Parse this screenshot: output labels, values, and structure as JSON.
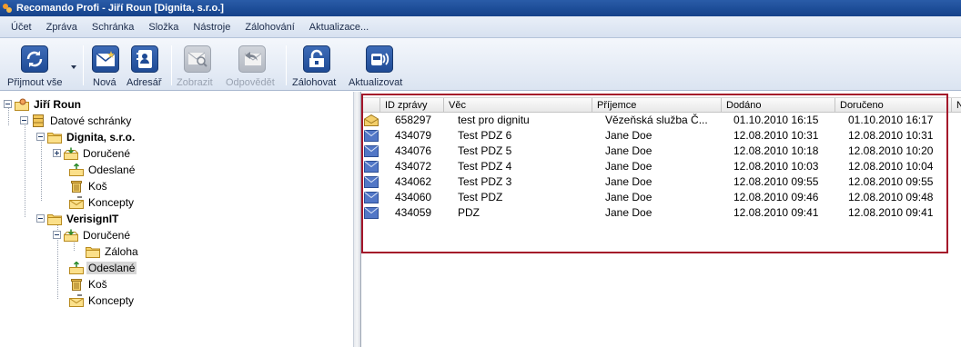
{
  "window": {
    "title": "Recomando Profi - Jiří Roun [Dignita, s.r.o.]"
  },
  "menu": [
    "Účet",
    "Zpráva",
    "Schránka",
    "Složka",
    "Nástroje",
    "Zálohování",
    "Aktualizace..."
  ],
  "toolbar": {
    "receive_all": "Přijmout vše",
    "new": "Nová",
    "address_book": "Adresář",
    "show": "Zobrazit",
    "reply": "Odpovědět",
    "backup": "Zálohovat",
    "update": "Aktualizovat"
  },
  "tree": {
    "root": "Jiří Roun",
    "boxes": "Datové schránky",
    "account1": "Dignita, s.r.o.",
    "account1_items": [
      "Doručené",
      "Odeslané",
      "Koš",
      "Koncepty"
    ],
    "account2": "VerisignIT",
    "account2_inbox": "Doručené",
    "account2_inbox_sub": "Záloha",
    "account2_items": [
      "Odeslané",
      "Koš",
      "Koncepty"
    ]
  },
  "list": {
    "columns": [
      "ID zprávy",
      "Věc",
      "Příjemce",
      "Dodáno",
      "Doručeno",
      "N"
    ],
    "rows": [
      {
        "icon": "open-envelope-icon",
        "id": "658297",
        "subject": "test pro dignitu",
        "recipient": "Vězeňská služba Č...",
        "delivered": "01.10.2010 16:15",
        "received": "01.10.2010 16:17"
      },
      {
        "icon": "envelope-icon",
        "id": "434079",
        "subject": "Test PDZ 6",
        "recipient": "Jane Doe",
        "delivered": "12.08.2010 10:31",
        "received": "12.08.2010 10:31"
      },
      {
        "icon": "envelope-icon",
        "id": "434076",
        "subject": "Test PDZ 5",
        "recipient": "Jane Doe",
        "delivered": "12.08.2010 10:18",
        "received": "12.08.2010 10:20"
      },
      {
        "icon": "envelope-icon",
        "id": "434072",
        "subject": "Test PDZ 4",
        "recipient": "Jane Doe",
        "delivered": "12.08.2010 10:03",
        "received": "12.08.2010 10:04"
      },
      {
        "icon": "envelope-icon",
        "id": "434062",
        "subject": "Test PDZ 3",
        "recipient": "Jane Doe",
        "delivered": "12.08.2010 09:55",
        "received": "12.08.2010 09:55"
      },
      {
        "icon": "envelope-icon",
        "id": "434060",
        "subject": "Test PDZ",
        "recipient": "Jane Doe",
        "delivered": "12.08.2010 09:46",
        "received": "12.08.2010 09:48"
      },
      {
        "icon": "envelope-icon",
        "id": "434059",
        "subject": "PDZ",
        "recipient": "Jane Doe",
        "delivered": "12.08.2010 09:41",
        "received": "12.08.2010 09:41"
      }
    ]
  },
  "colors": {
    "title_bar": "#1d4d98",
    "highlight_border": "#a4162a",
    "selection": "#d6d6d6"
  }
}
